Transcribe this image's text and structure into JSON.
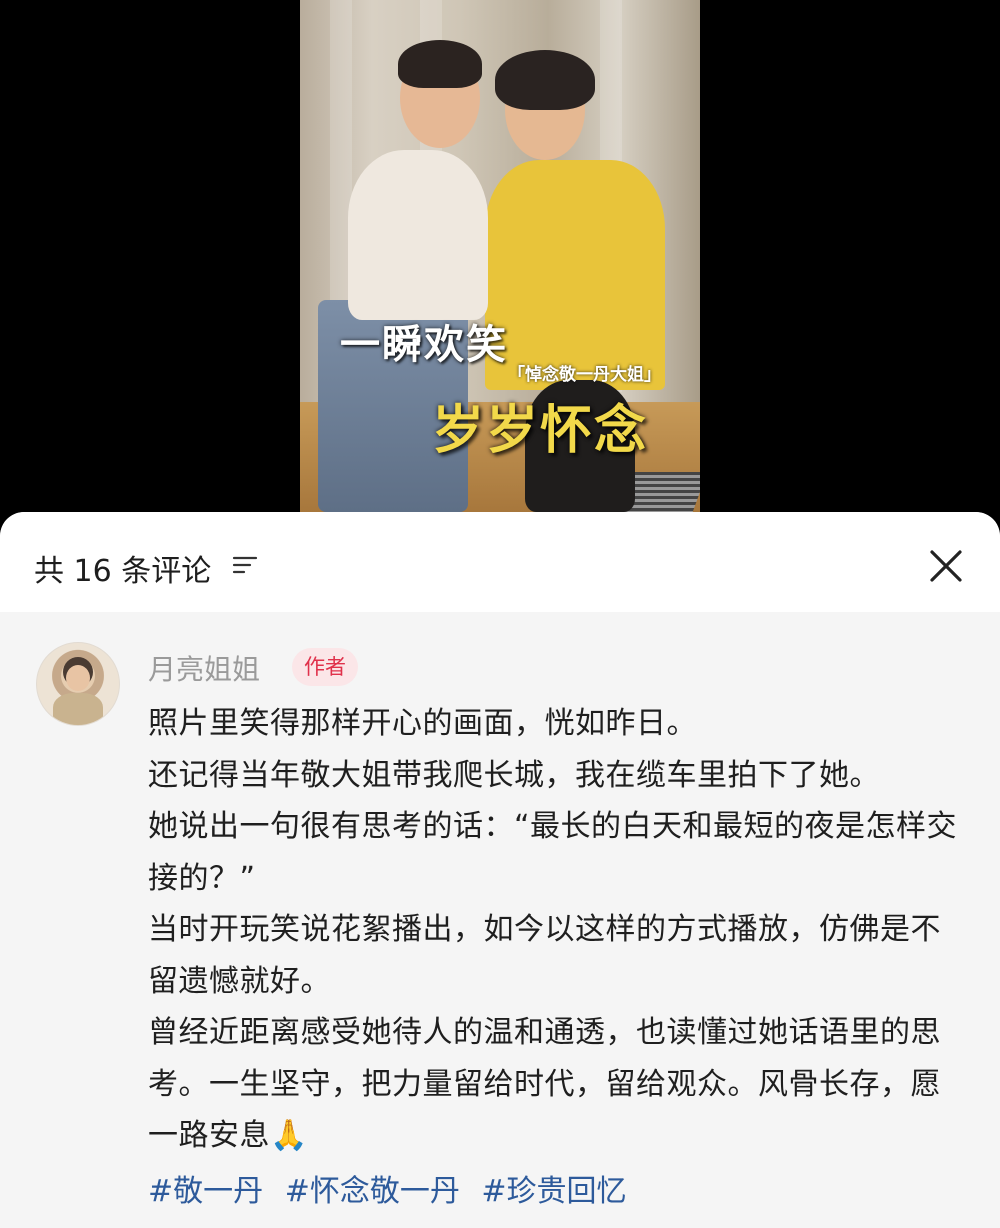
{
  "video": {
    "caption_main": "一瞬欢笑",
    "caption_sub": "「悼念敬一丹大姐」",
    "caption_large": "岁岁怀念",
    "caption_large_color": "#f2d94a"
  },
  "comments_panel": {
    "title": "共 16 条评论",
    "sort_icon": "sort-lines-icon",
    "close_icon": "close-x-icon"
  },
  "comment": {
    "username": "月亮姐姐",
    "badge": "作者",
    "badge_color": "#e0314b",
    "lines": [
      "照片里笑得那样开心的画面，恍如昨日。",
      "还记得当年敬大姐带我爬长城，我在缆车里拍下了她。",
      "她说出一句很有思考的话：“最长的白天和最短的夜是怎样交接的？”",
      "当时开玩笑说花絮播出，如今以这样的方式播放，仿佛是不留遗憾就好。",
      "曾经近距离感受她待人的温和通透，也读懂过她话语里的思考。一生坚守，把力量留给时代，留给观众。风骨长存，愿一路安息"
    ],
    "emoji": "🙏",
    "tags": [
      "#敬一丹",
      "#怀念敬一丹",
      "#珍贵回忆"
    ],
    "tag_color": "#2d5a9b"
  }
}
